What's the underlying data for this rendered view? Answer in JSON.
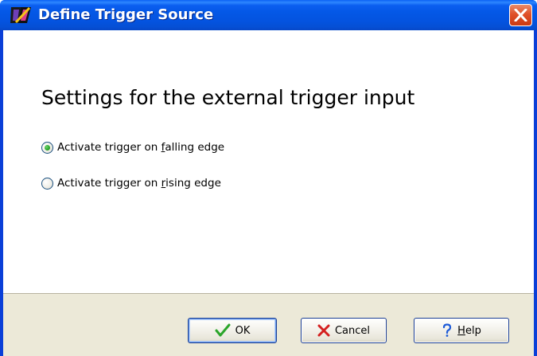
{
  "window": {
    "title": "Define Trigger Source"
  },
  "content": {
    "heading": "Settings for the external trigger input",
    "options": [
      {
        "prefix": "Activate trigger on ",
        "mnemonic": "f",
        "suffix": "alling edge",
        "selected": true
      },
      {
        "prefix": "Activate trigger on ",
        "mnemonic": "r",
        "suffix": "ising edge",
        "selected": false
      }
    ]
  },
  "buttons": {
    "ok_label": "OK",
    "cancel_label": "Cancel",
    "help_mnemonic": "H",
    "help_rest": "elp"
  },
  "icons": {
    "title": "app-logo-icon",
    "close": "close-icon",
    "ok": "checkmark-icon",
    "cancel": "x-icon",
    "help": "question-mark-icon"
  },
  "colors": {
    "titlebar": "#0458e6",
    "close_button": "#e0512a",
    "button_bar": "#ece9d8",
    "radio_selected": "#2aa52a",
    "ok_check": "#2aa52a",
    "cancel_x": "#d42020",
    "help_question": "#1c5ad8"
  }
}
